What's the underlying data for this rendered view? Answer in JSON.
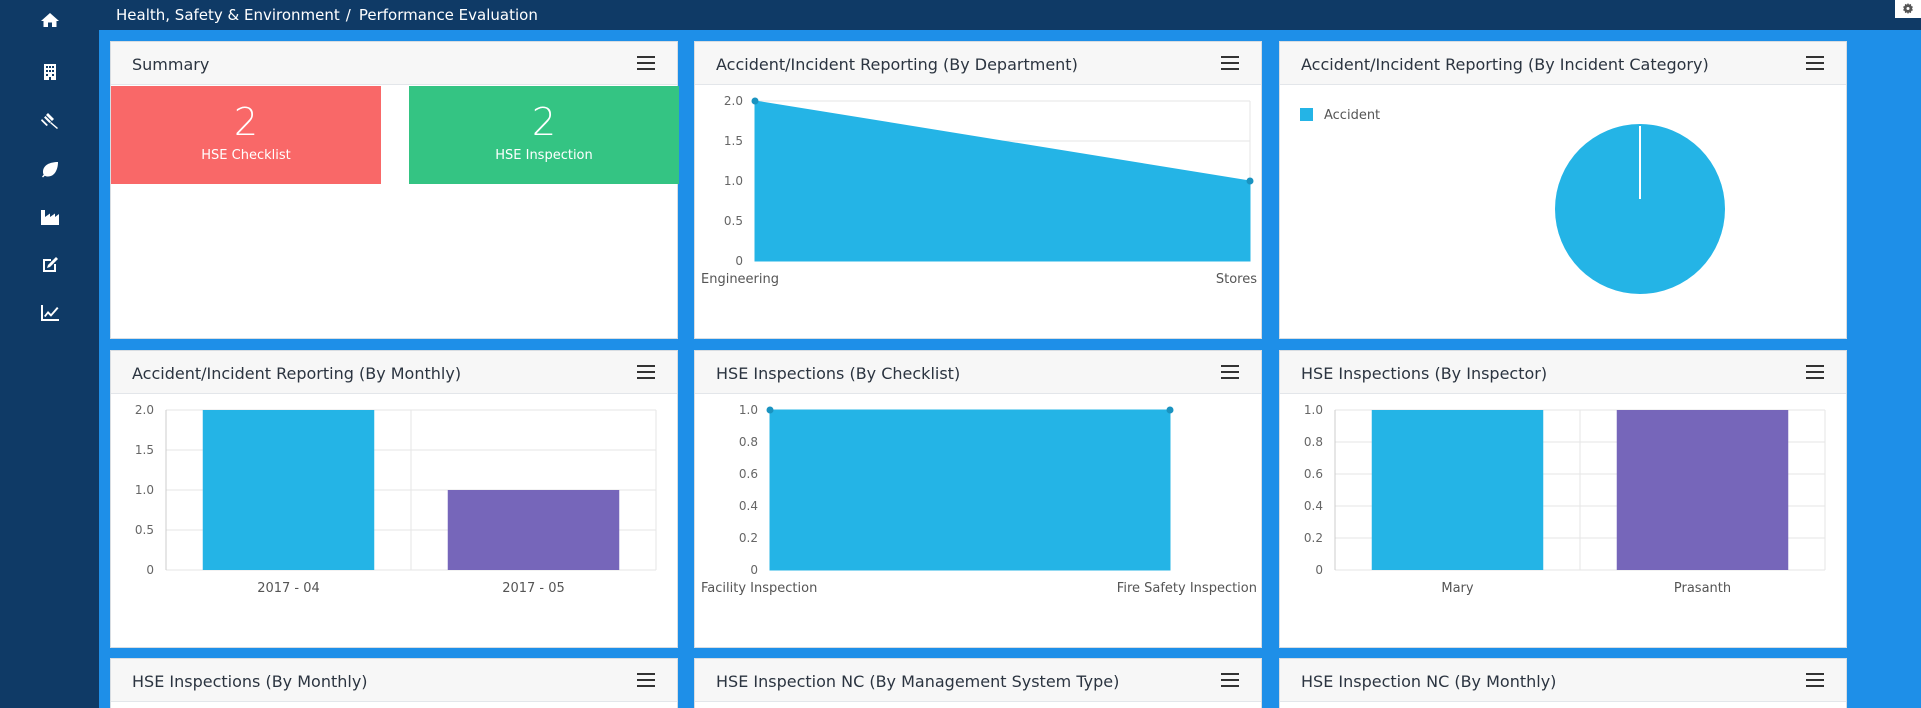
{
  "breadcrumb": {
    "section": "Health, Safety & Environment",
    "separator": "/",
    "page": "Performance Evaluation"
  },
  "sidebar": {
    "items": [
      {
        "icon": "home-icon"
      },
      {
        "icon": "building-icon"
      },
      {
        "icon": "gavel-icon"
      },
      {
        "icon": "leaf-icon"
      },
      {
        "icon": "factory-icon"
      },
      {
        "icon": "edit-icon"
      },
      {
        "icon": "line-chart-icon"
      }
    ]
  },
  "topbar": {
    "settings_icon": "gear-icon"
  },
  "colors": {
    "sidebar": "#0f3a66",
    "background": "#1e8fe8",
    "chart_blue": "#24b4e6",
    "chart_purple": "#7666ba",
    "tile_red": "#f96868",
    "tile_green": "#34c483"
  },
  "cards": {
    "summary": {
      "title": "Summary",
      "tiles": [
        {
          "value": "2",
          "label": "HSE Checklist"
        },
        {
          "value": "2",
          "label": "HSE Inspection"
        }
      ]
    },
    "by_department": {
      "title": "Accident/Incident Reporting (By Department)"
    },
    "by_category": {
      "title": "Accident/Incident Reporting (By Incident Category)"
    },
    "by_monthly": {
      "title": "Accident/Incident Reporting (By Monthly)"
    },
    "insp_checklist": {
      "title": "HSE Inspections (By Checklist)"
    },
    "insp_inspector": {
      "title": "HSE Inspections (By Inspector)"
    },
    "insp_monthly": {
      "title": "HSE Inspections (By Monthly)"
    },
    "nc_system": {
      "title": "HSE Inspection NC (By Management System Type)"
    },
    "nc_monthly": {
      "title": "HSE Inspection NC (By Monthly)"
    }
  },
  "chart_data": [
    {
      "id": "by_department",
      "type": "area",
      "categories": [
        "Engineering",
        "Stores"
      ],
      "values": [
        2,
        1
      ],
      "ylim": [
        0,
        2
      ],
      "yticks": [
        "0",
        "0.5",
        "1.0",
        "1.5",
        "2.0"
      ],
      "color": "#24b4e6"
    },
    {
      "id": "by_category",
      "type": "pie",
      "labels": [
        "Accident"
      ],
      "values": [
        2
      ],
      "legend": "top-left",
      "color": "#24b4e6"
    },
    {
      "id": "by_monthly",
      "type": "bar",
      "categories": [
        "2017 - 04",
        "2017 - 05"
      ],
      "values": [
        2,
        1
      ],
      "ylim": [
        0,
        2
      ],
      "yticks": [
        "0",
        "0.5",
        "1.0",
        "1.5",
        "2.0"
      ],
      "colors": [
        "#24b4e6",
        "#7666ba"
      ]
    },
    {
      "id": "insp_checklist",
      "type": "area",
      "categories": [
        "Facility Inspection",
        "Fire Safety Inspection"
      ],
      "values": [
        1,
        1
      ],
      "ylim": [
        0,
        1
      ],
      "yticks": [
        "0",
        "0.2",
        "0.4",
        "0.6",
        "0.8",
        "1.0"
      ],
      "color": "#24b4e6"
    },
    {
      "id": "insp_inspector",
      "type": "bar",
      "categories": [
        "Mary",
        "Prasanth"
      ],
      "values": [
        1,
        1
      ],
      "ylim": [
        0,
        1
      ],
      "yticks": [
        "0",
        "0.2",
        "0.4",
        "0.6",
        "0.8",
        "1.0"
      ],
      "colors": [
        "#24b4e6",
        "#7666ba"
      ]
    }
  ]
}
